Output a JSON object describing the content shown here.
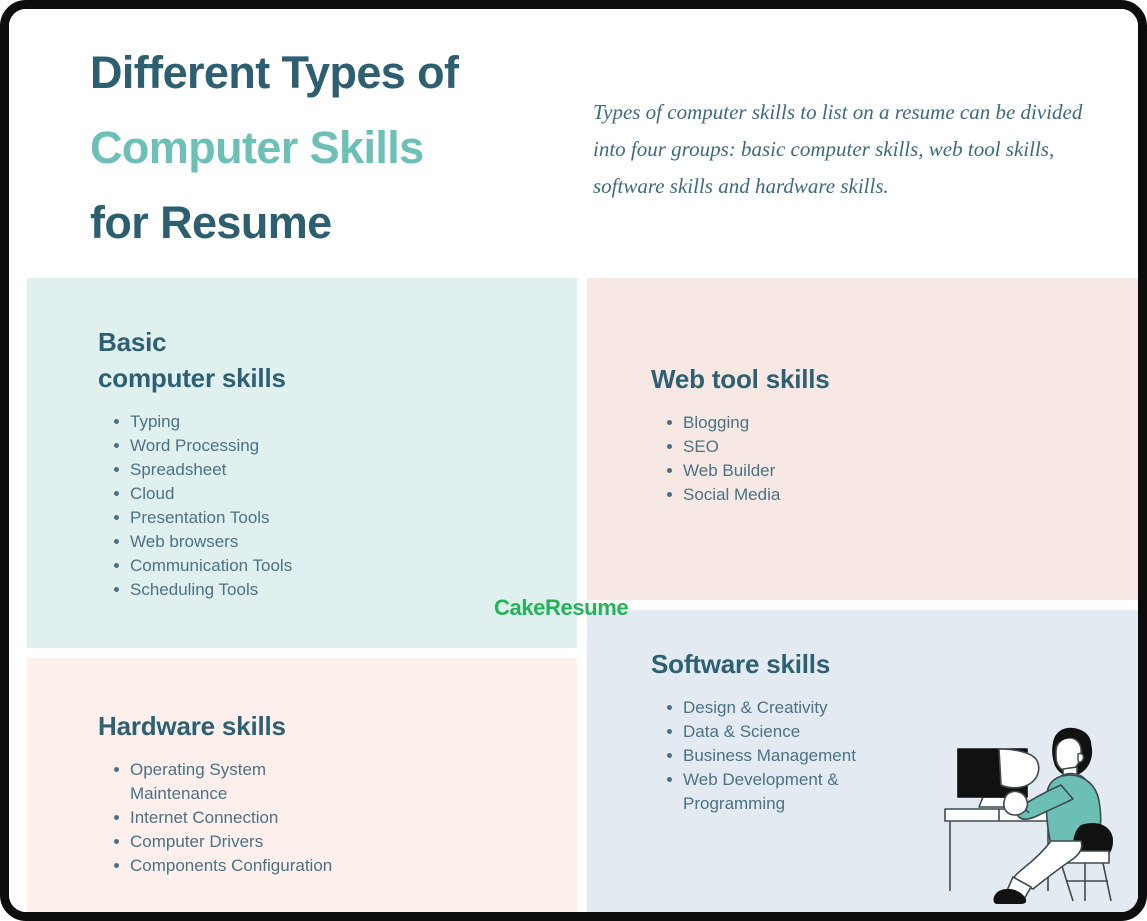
{
  "header": {
    "title_lines": [
      {
        "text": "Different Types of",
        "accent": false
      },
      {
        "text": "Computer Skills",
        "accent": true
      },
      {
        "text": "for Resume",
        "accent": false
      }
    ],
    "intro": "Types of computer skills to list on a resume can be divided into four groups: basic computer skills, web tool skills, software skills and hardware skills."
  },
  "brand": {
    "logo_text": "CakeResume",
    "logo_color": "#23b358"
  },
  "colors": {
    "title_dark": "#2d5f70",
    "title_accent": "#6cc0b5",
    "heading": "#2d6073",
    "body_text": "#4a7285",
    "panel_basic_bg": "#e0f0ef",
    "panel_web_bg": "#f8e8e4",
    "panel_hardware_bg": "#fcefec",
    "panel_software_bg": "#e3eaf2",
    "frame": "#0d0d0d"
  },
  "panels": {
    "basic": {
      "heading_line1": "Basic",
      "heading_line2": "computer skills",
      "items": [
        "Typing",
        "Word Processing",
        "Spreadsheet",
        "Cloud",
        "Presentation Tools",
        "Web browsers",
        "Communication Tools",
        "Scheduling Tools"
      ]
    },
    "web": {
      "heading": "Web tool skills",
      "items": [
        "Blogging",
        "SEO",
        "Web Builder",
        "Social Media"
      ]
    },
    "hardware": {
      "heading": "Hardware skills",
      "items": [
        "Operating System Maintenance",
        "Internet Connection",
        "Computer Drivers",
        "Components Configuration"
      ]
    },
    "software": {
      "heading": "Software skills",
      "items": [
        "Design & Creativity",
        "Data & Science",
        "Business Management",
        "Web Development & Programming"
      ]
    }
  },
  "illustration": {
    "name": "person-at-desk-with-computer"
  }
}
